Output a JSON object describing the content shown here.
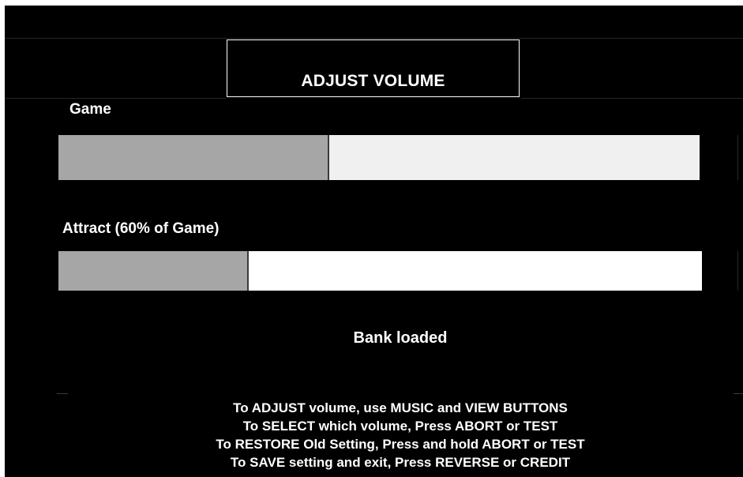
{
  "title": "ADJUST VOLUME",
  "sliders": [
    {
      "label": "Game",
      "level_fraction": 0.423
    },
    {
      "label": "Attract (60% of Game)",
      "level_fraction": 0.296
    }
  ],
  "status_text": "Bank loaded",
  "instructions": [
    "To ADJUST volume, use MUSIC and VIEW BUTTONS",
    "To SELECT which volume, Press ABORT or TEST",
    "To RESTORE Old Setting, Press and hold ABORT or TEST",
    "To SAVE setting and exit, Press REVERSE or CREDIT"
  ],
  "colors": {
    "background": "#000000",
    "text": "#ffffff",
    "bar_fill": "#a6a6a6",
    "bar_track": "#f2f2f2"
  }
}
